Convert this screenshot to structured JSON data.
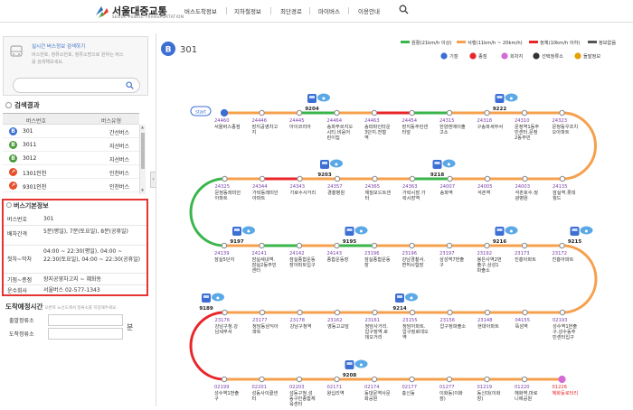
{
  "header": {
    "logo_text": "서울대중교통",
    "logo_sub": "SEOUL PUBLIC TRANSPORTATION",
    "nav": [
      "버스도착정보",
      "지하철정보",
      "최단경로",
      "마이버스",
      "이용안내"
    ]
  },
  "search": {
    "title": "실시간 버스정보 검색하기",
    "desc": "버스번호, 정류소번호, 정류소명으로 원하는 버스를 검색해보세요."
  },
  "results": {
    "heading": "검색결과",
    "col_no": "버스번호",
    "col_type": "버스유형",
    "rows": [
      {
        "no": "301",
        "type": "간선버스",
        "icon": "B",
        "color": "#3c6ed4"
      },
      {
        "no": "3011",
        "type": "지선버스",
        "icon": "B",
        "color": "#4a9a3a"
      },
      {
        "no": "3012",
        "type": "지선버스",
        "icon": "B",
        "color": "#4a9a3a"
      },
      {
        "no": "1301인천",
        "type": "인천버스",
        "icon": "↗",
        "color": "#e84e2a"
      },
      {
        "no": "9301인천",
        "type": "인천버스",
        "icon": "↗",
        "color": "#e84e2a"
      }
    ]
  },
  "info": {
    "title": "버스기본정보",
    "rows": [
      {
        "label": "버스번호",
        "value": "301"
      },
      {
        "label": "배차간격",
        "value": "5분(평일), 7분(토요일), 8분(공휴일)"
      },
      {
        "label": "첫차~막차",
        "value": "04:00 ~ 22:30(평일), 04:00 ~ 22:30(토요일), 04:00 ~ 22:30(공휴일)"
      },
      {
        "label": "기점~종점",
        "value": "장지공영차고지 ~ 혜화동"
      },
      {
        "label": "운수회사",
        "value": "서울버스 02-577-1343"
      }
    ]
  },
  "eta": {
    "heading": "도착예정시간",
    "hint": "오른쪽 노선도에서 정류소를 지정해주세요.",
    "from_label": "출발정류소",
    "to_label": "도착정류소",
    "unit": "분"
  },
  "route": {
    "bus_no": "301",
    "legend_speed": [
      {
        "label": "원활(21km/h 이상)",
        "color": "#39b54a"
      },
      {
        "label": "서행(11km/h ~ 20km/h)",
        "color": "#f6a04d"
      },
      {
        "label": "정체(10km/h 이하)",
        "color": "#e8262a"
      },
      {
        "label": "정보없음",
        "color": "#555555"
      }
    ],
    "legend_marks": [
      "기점",
      "종점",
      "회차지",
      "선택정류소",
      "돌발정보"
    ],
    "start_label": "start",
    "rows": [
      {
        "stops": [
          {
            "id": "24460",
            "name": "서울버스종점"
          },
          {
            "id": "24446",
            "name": "장지공영차고지"
          },
          {
            "id": "24445",
            "name": "아이코리아"
          },
          {
            "id": "24464",
            "name": "송파푸르지오시티.비응어린이집"
          },
          {
            "id": "24463",
            "name": "송파파인타운3단지.전철역"
          },
          {
            "id": "24454",
            "name": "장지동주민센터앞"
          },
          {
            "id": "24315",
            "name": "한양엔에이출고소"
          },
          {
            "id": "24318",
            "name": "구송파세무서"
          },
          {
            "id": "24310",
            "name": "문정역1동주민센터.문정2동주민"
          },
          {
            "id": "24323",
            "name": "문정동우조치오아파트"
          }
        ],
        "buses": [
          {
            "no": "9204",
            "after": 2
          },
          {
            "no": "9222",
            "after": 7
          }
        ]
      },
      {
        "stops": [
          {
            "id": "24135",
            "name": "잠실역.롯데월드"
          },
          {
            "id": "24003",
            "name": "석촌호수.정광병원"
          },
          {
            "id": "24005",
            "name": "석촌역"
          },
          {
            "id": "24007",
            "name": "송파역"
          },
          {
            "id": "24363",
            "name": "가락시장.가락시장역"
          },
          {
            "id": "24365",
            "name": "체질모드트센터"
          },
          {
            "id": "24357",
            "name": "경찰병원"
          },
          {
            "id": "24343",
            "name": "가로수사거리"
          },
          {
            "id": "24344",
            "name": "가락동래미안아파트"
          },
          {
            "id": "24325",
            "name": "문정동래미안아파트"
          }
        ],
        "buses": [
          {
            "no": "9218",
            "after": 3
          },
          {
            "no": "9203",
            "after": 6
          }
        ]
      },
      {
        "stops": [
          {
            "id": "24139",
            "name": "잠실5단지"
          },
          {
            "id": "24141",
            "name": "잠실새내역.잠실2동주민센터"
          },
          {
            "id": "24142",
            "name": "잠실종합운동장아파트입구"
          },
          {
            "id": "24143",
            "name": "종합운동장"
          },
          {
            "id": "23196",
            "name": "잠실종합운동장"
          },
          {
            "id": "23196",
            "name": "강남경찰서.면허시험장"
          },
          {
            "id": "23197",
            "name": "삼성역7번출구"
          },
          {
            "id": "23192",
            "name": "봉은사역2번출구.상성1파출소"
          },
          {
            "id": "23173",
            "name": "진흥아파트"
          },
          {
            "id": "23172",
            "name": "진흥아파트"
          }
        ],
        "buses": [
          {
            "no": "9197",
            "after": 0
          },
          {
            "no": "9195",
            "after": 3
          },
          {
            "no": "9216",
            "after": 7
          },
          {
            "no": "9215",
            "after": 9
          }
        ]
      },
      {
        "stops": [
          {
            "id": "02193",
            "name": "성수역1번출구.성수동주민센터입구"
          },
          {
            "id": "04155",
            "name": "뚝섬역"
          },
          {
            "id": "23148",
            "name": "현대아파트"
          },
          {
            "id": "23156",
            "name": "압구정파출소"
          },
          {
            "id": "23155",
            "name": "청담아파트.압구정로데오역"
          },
          {
            "id": "23161",
            "name": "청담사거리.압구정역.로데오거리"
          },
          {
            "id": "23162",
            "name": "영동고교앞"
          },
          {
            "id": "23178",
            "name": "강남구청역"
          },
          {
            "id": "23177",
            "name": "청담동삼익아파트"
          },
          {
            "id": "23176",
            "name": "강남구청.강남세무서"
          }
        ],
        "buses": [
          {
            "no": "9214",
            "after": 4
          },
          {
            "no": "9189",
            "after": 0
          }
        ]
      },
      {
        "stops": [
          {
            "id": "02199",
            "name": "성수역1번출구"
          },
          {
            "id": "02201",
            "name": "성동사이클센터"
          },
          {
            "id": "02203",
            "name": "성동구청.성동구민종합체육센터"
          },
          {
            "id": "02171",
            "name": "왕십리역"
          },
          {
            "id": "02174",
            "name": "동대문역사문화공원"
          },
          {
            "id": "02177",
            "name": "충신동"
          },
          {
            "id": "01277",
            "name": "이화동(이화장)"
          },
          {
            "id": "01219",
            "name": "동신대(이화장)"
          },
          {
            "id": "01220",
            "name": "혜화역.마로니에공원"
          },
          {
            "id": "01226",
            "name": "혜화동로터리"
          }
        ],
        "buses": [
          {
            "no": "9208",
            "after": 3
          }
        ]
      }
    ]
  }
}
